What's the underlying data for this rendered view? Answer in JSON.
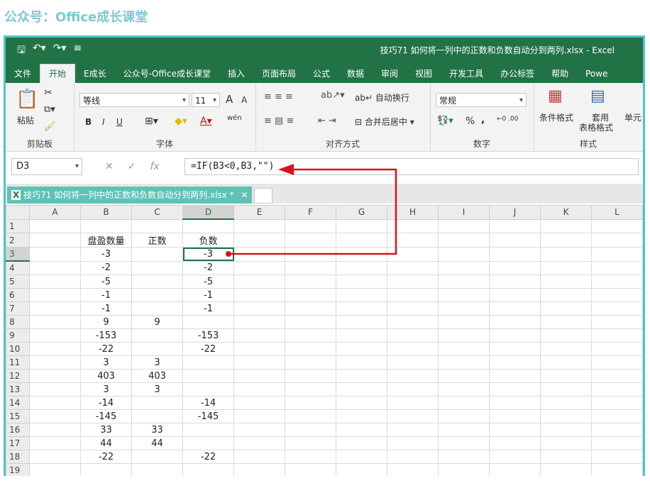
{
  "watermark": "公众号：Office成长课堂",
  "window": {
    "title": "技巧71  如何将一列中的正数和负数自动分到两列.xlsx  -  Excel"
  },
  "tabs": [
    "文件",
    "开始",
    "E成长",
    "公众号-Office成长课堂",
    "插入",
    "页面布局",
    "公式",
    "数据",
    "审阅",
    "视图",
    "开发工具",
    "办公标签",
    "帮助",
    "Powe"
  ],
  "active_tab": "开始",
  "ribbon": {
    "clipboard": {
      "paste": "粘贴",
      "label": "剪贴板"
    },
    "font": {
      "name": "等线",
      "size": "11",
      "grow": "A",
      "shrink": "A",
      "bold": "B",
      "italic": "I",
      "underline": "U",
      "wen": "wén",
      "label": "字体"
    },
    "align": {
      "wrap": "自动换行",
      "merge": "合并后居中",
      "label": "对齐方式"
    },
    "number": {
      "format": "常规",
      "percent": "%",
      "comma": ",",
      "label": "数字"
    },
    "styles": {
      "conditional": "条件格式",
      "table_format_1": "套用",
      "table_format_2": "表格格式",
      "cell": "单元",
      "label": "样式"
    }
  },
  "formula_bar": {
    "name_box": "D3",
    "formula": "=IF(B3<0,B3,\"\")"
  },
  "workbook_tab": {
    "label": "技巧71  如何将一列中的正数和负数自动分到两列.xlsx *"
  },
  "sheet": {
    "columns": [
      "A",
      "B",
      "C",
      "D",
      "E",
      "F",
      "G",
      "H",
      "I",
      "J",
      "K",
      "L"
    ],
    "rows": [
      {
        "n": "1",
        "b": "",
        "c": "",
        "d": ""
      },
      {
        "n": "2",
        "b": "盘盈数量",
        "c": "正数",
        "d": "负数"
      },
      {
        "n": "3",
        "b": "-3",
        "c": "",
        "d": "-3"
      },
      {
        "n": "4",
        "b": "-2",
        "c": "",
        "d": "-2"
      },
      {
        "n": "5",
        "b": "-5",
        "c": "",
        "d": "-5"
      },
      {
        "n": "6",
        "b": "-1",
        "c": "",
        "d": "-1"
      },
      {
        "n": "7",
        "b": "-1",
        "c": "",
        "d": "-1"
      },
      {
        "n": "8",
        "b": "9",
        "c": "9",
        "d": ""
      },
      {
        "n": "9",
        "b": "-153",
        "c": "",
        "d": "-153"
      },
      {
        "n": "10",
        "b": "-22",
        "c": "",
        "d": "-22"
      },
      {
        "n": "11",
        "b": "3",
        "c": "3",
        "d": ""
      },
      {
        "n": "12",
        "b": "403",
        "c": "403",
        "d": ""
      },
      {
        "n": "13",
        "b": "3",
        "c": "3",
        "d": ""
      },
      {
        "n": "14",
        "b": "-14",
        "c": "",
        "d": "-14"
      },
      {
        "n": "15",
        "b": "-145",
        "c": "",
        "d": "-145"
      },
      {
        "n": "16",
        "b": "33",
        "c": "33",
        "d": ""
      },
      {
        "n": "17",
        "b": "44",
        "c": "44",
        "d": ""
      },
      {
        "n": "18",
        "b": "-22",
        "c": "",
        "d": "-22"
      },
      {
        "n": "19",
        "b": "",
        "c": "",
        "d": ""
      }
    ],
    "selected": "D3"
  },
  "colors": {
    "excel_green": "#217346",
    "frame": "#4fc3c6",
    "annotation": "#d9131c"
  }
}
